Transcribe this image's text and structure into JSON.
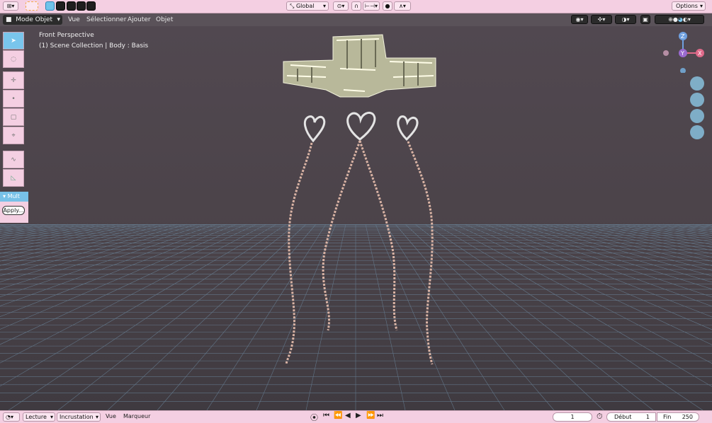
{
  "toolbar": {
    "transform_orientation": "Global",
    "options_label": "Options"
  },
  "header": {
    "mode": "Mode Objet",
    "menus": [
      "Vue",
      "Sélectionner",
      "Ajouter",
      "Objet"
    ]
  },
  "viewport": {
    "view_name": "Front Perspective",
    "collection_info": "(1) Scene Collection | Body : Basis",
    "gizmo": {
      "z": "Z",
      "y": "Y",
      "x": "X"
    }
  },
  "tools": [
    "select-box",
    "select-circle",
    "cursor",
    "move",
    "scale",
    "transform",
    "draw",
    "measure"
  ],
  "operator_panel": {
    "title": "Mult",
    "apply_label": "Apply..."
  },
  "timeline": {
    "playback": "Lecture",
    "keying": "Incrustation",
    "view": "Vue",
    "markers": "Marqueur",
    "current_frame": "1",
    "start_label": "Début",
    "start_value": "1",
    "end_label": "Fin",
    "end_value": "250"
  },
  "colors": {
    "accent": "#79c5ec",
    "ui_pink": "#f4cfe2",
    "grid": "#6f8ea6",
    "chain": "#d9b3a4",
    "metal": "#c8c8b0"
  }
}
